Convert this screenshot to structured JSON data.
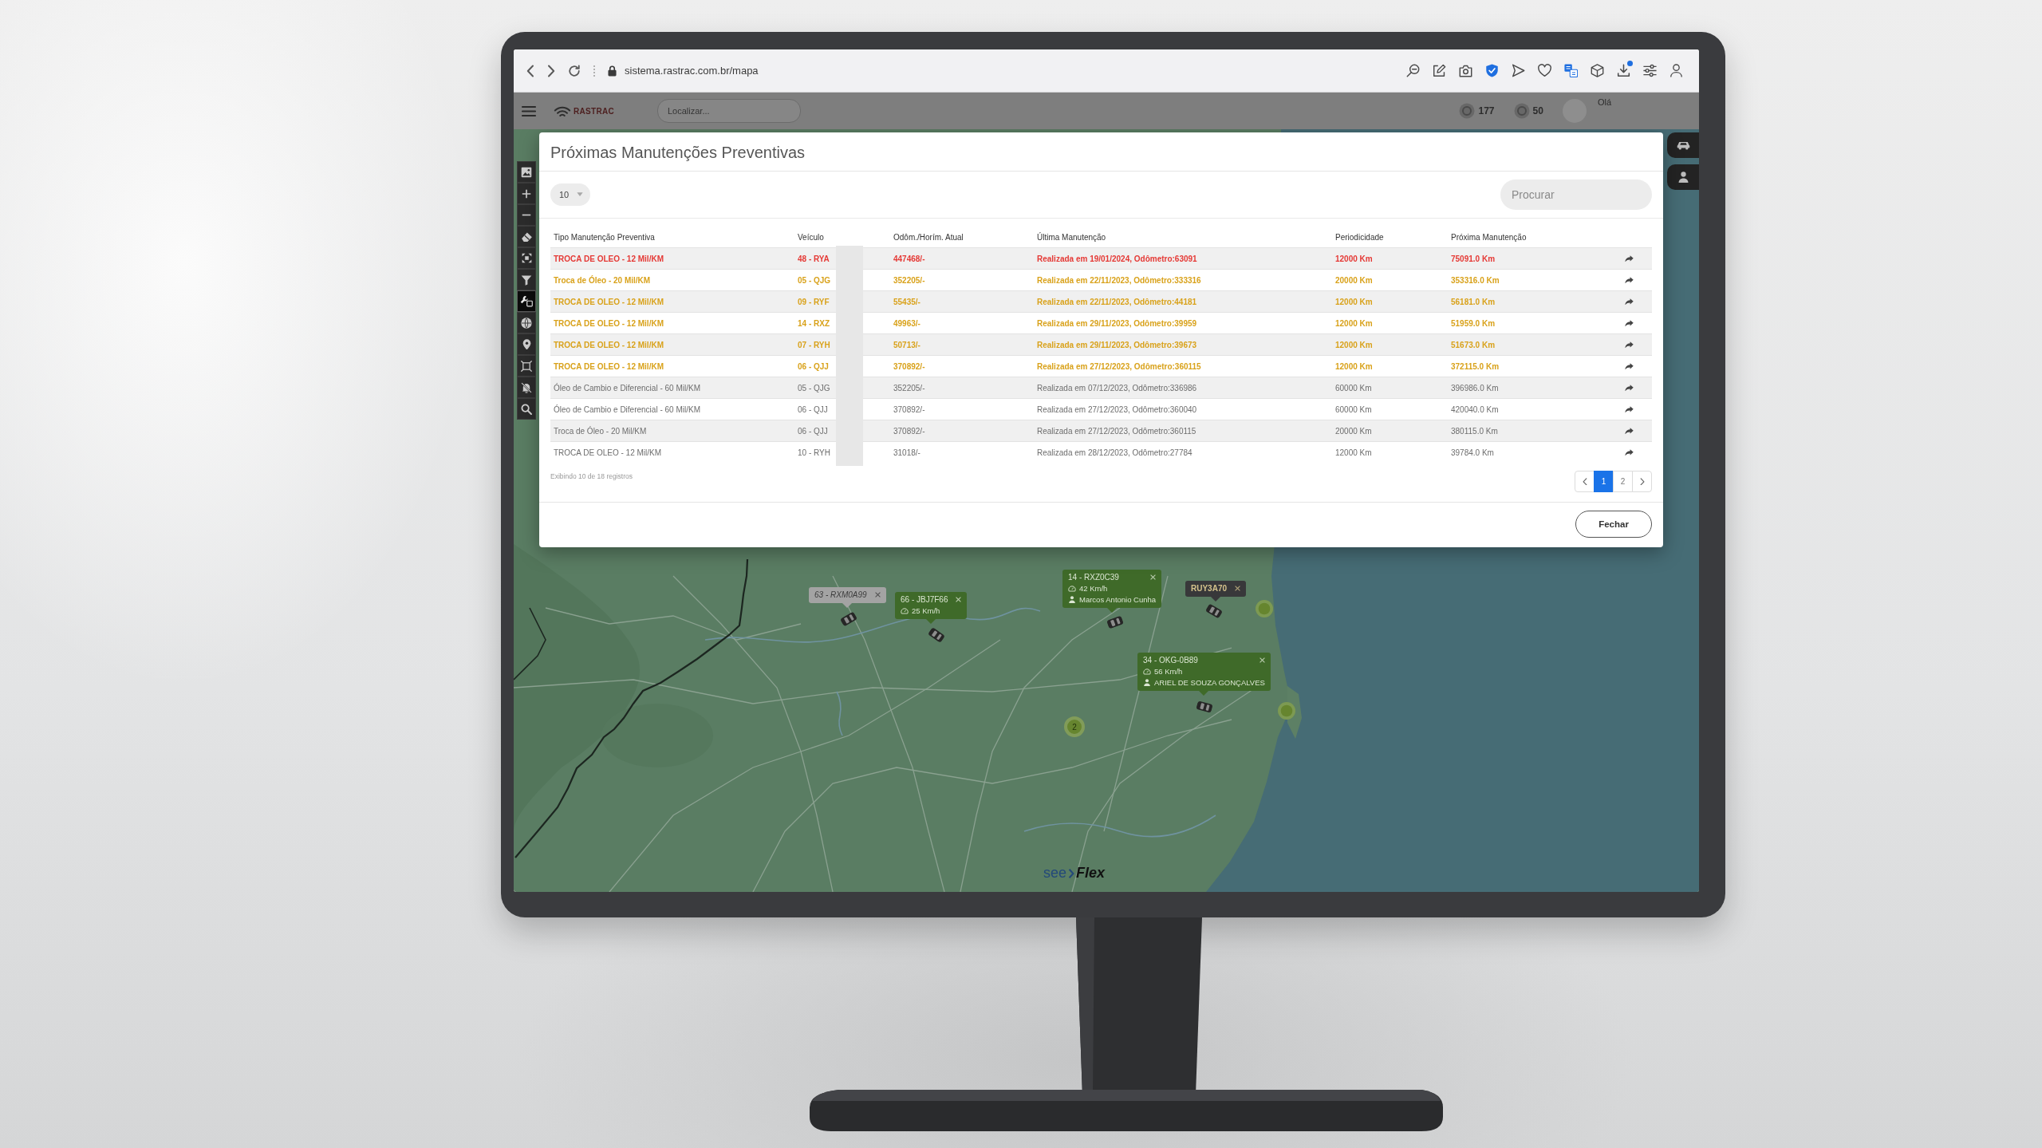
{
  "browser": {
    "url": "sistema.rastrac.com.br/mapa",
    "extensions": [
      {
        "kind": "zoom",
        "badge": false
      },
      {
        "kind": "edit",
        "badge": false
      },
      {
        "kind": "camera",
        "badge": false
      },
      {
        "kind": "shield",
        "badge": false
      },
      {
        "kind": "send",
        "badge": false
      },
      {
        "kind": "heart",
        "badge": false
      },
      {
        "kind": "translate",
        "badge": false
      },
      {
        "kind": "cube",
        "badge": false
      },
      {
        "kind": "download",
        "badge": true
      },
      {
        "kind": "sliders",
        "badge": false
      },
      {
        "kind": "profile",
        "badge": false
      }
    ]
  },
  "app_header": {
    "logo": "RASTRAC",
    "search": {
      "placeholder": "Localizar..."
    },
    "counters": [
      "177",
      "50"
    ],
    "greeting": "Olá"
  },
  "map": {
    "tools": [
      {
        "kind": "image",
        "selected": false
      },
      {
        "kind": "zoomin",
        "selected": false
      },
      {
        "kind": "zoomout",
        "selected": false
      },
      {
        "kind": "eraser",
        "selected": false
      },
      {
        "kind": "fit",
        "selected": false
      },
      {
        "kind": "filter",
        "selected": false
      },
      {
        "kind": "maintenance",
        "selected": true
      },
      {
        "kind": "globe",
        "selected": false
      },
      {
        "kind": "pin",
        "selected": false
      },
      {
        "kind": "area",
        "selected": false
      },
      {
        "kind": "alerts",
        "selected": false
      },
      {
        "kind": "search",
        "selected": false
      }
    ],
    "side_buttons": [
      {
        "kind": "car"
      },
      {
        "kind": "person"
      }
    ],
    "popups": [
      {
        "kind": "plain",
        "plate": "63 - RXM0A99"
      },
      {
        "kind": "detail",
        "plate": "66 - JBJ7F66",
        "speed": "25 Km/h"
      },
      {
        "kind": "detail",
        "plate": "14 - RXZ0C39",
        "speed": "42 Km/h",
        "driver": "Marcos Antonio Cunha"
      },
      {
        "kind": "dark",
        "plate": "RUY3A70"
      },
      {
        "kind": "detail",
        "plate": "34 - OKG-0B89",
        "speed": "56 Km/h",
        "driver": "ARIEL DE SOUZA GONÇALVES"
      }
    ],
    "clusters": [
      {
        "count": "2"
      }
    ],
    "brand": [
      "see",
      "Flex"
    ]
  },
  "modal": {
    "title": "Próximas Manutenções Preventivas",
    "page_size": "10",
    "search": {
      "placeholder": "Procurar"
    },
    "table": {
      "columns": [
        "Tipo Manutenção Preventiva",
        "Veículo",
        "Odôm./Horím. Atual",
        "Última Manutenção",
        "Periodicidade",
        "Próxima Manutenção"
      ],
      "rows": [
        {
          "color": "#e53935",
          "bold": true,
          "cells": [
            "TROCA DE OLEO - 12 Mil/KM",
            "48 - RYA",
            "447468/-",
            "Realizada em 19/01/2024, Odômetro:63091",
            "12000 Km",
            "75091.0 Km"
          ]
        },
        {
          "color": "#d9a21b",
          "bold": true,
          "cells": [
            "Troca de Óleo - 20 Mil/KM",
            "05 - QJG",
            "352205/-",
            "Realizada em 22/11/2023, Odômetro:333316",
            "20000 Km",
            "353316.0 Km"
          ]
        },
        {
          "color": "#d9a21b",
          "bold": true,
          "cells": [
            "TROCA DE OLEO - 12 Mil/KM",
            "09 - RYF",
            "55435/-",
            "Realizada em 22/11/2023, Odômetro:44181",
            "12000 Km",
            "56181.0 Km"
          ]
        },
        {
          "color": "#d9a21b",
          "bold": true,
          "cells": [
            "TROCA DE OLEO - 12 Mil/KM",
            "14 - RXZ",
            "49963/-",
            "Realizada em 29/11/2023, Odômetro:39959",
            "12000 Km",
            "51959.0 Km"
          ]
        },
        {
          "color": "#d9a21b",
          "bold": true,
          "cells": [
            "TROCA DE OLEO - 12 Mil/KM",
            "07 - RYH",
            "50713/-",
            "Realizada em 29/11/2023, Odômetro:39673",
            "12000 Km",
            "51673.0 Km"
          ]
        },
        {
          "color": "#d9a21b",
          "bold": true,
          "cells": [
            "TROCA DE OLEO - 12 Mil/KM",
            "06 - QJJ",
            "370892/-",
            "Realizada em 27/12/2023, Odômetro:360115",
            "12000 Km",
            "372115.0 Km"
          ]
        },
        {
          "color": "#6d6d6d",
          "bold": false,
          "cells": [
            "Óleo de Cambio e Diferencial - 60 Mil/KM",
            "05 - QJG",
            "352205/-",
            "Realizada em 07/12/2023, Odômetro:336986",
            "60000 Km",
            "396986.0 Km"
          ]
        },
        {
          "color": "#6d6d6d",
          "bold": false,
          "cells": [
            "Óleo de Cambio e Diferencial - 60 Mil/KM",
            "06 - QJJ",
            "370892/-",
            "Realizada em 27/12/2023, Odômetro:360040",
            "60000 Km",
            "420040.0 Km"
          ]
        },
        {
          "color": "#6d6d6d",
          "bold": false,
          "cells": [
            "Troca de Óleo - 20 Mil/KM",
            "06 - QJJ",
            "370892/-",
            "Realizada em 27/12/2023, Odômetro:360115",
            "20000 Km",
            "380115.0 Km"
          ]
        },
        {
          "color": "#6d6d6d",
          "bold": false,
          "cells": [
            "TROCA DE OLEO - 12 Mil/KM",
            "10 - RYH",
            "31018/-",
            "Realizada em 28/12/2023, Odômetro:27784",
            "12000 Km",
            "39784.0 Km"
          ]
        }
      ]
    },
    "summary": "Exibindo 10 de 18 registros",
    "pagination": {
      "pages": [
        {
          "label": "1",
          "selected": true
        },
        {
          "label": "2",
          "selected": false
        }
      ]
    },
    "close_button": "Fechar"
  }
}
